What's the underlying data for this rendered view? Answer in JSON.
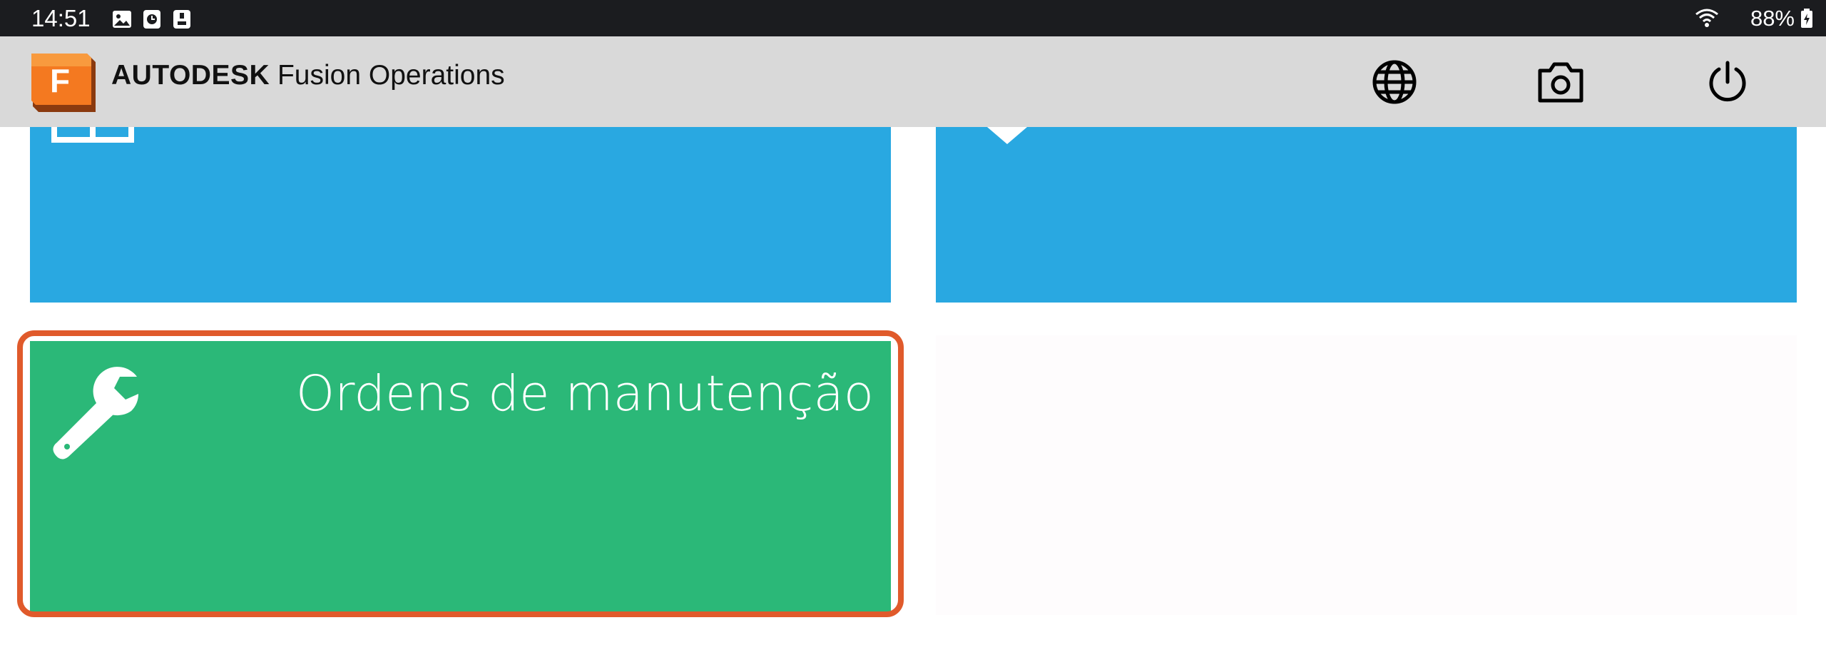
{
  "status_bar": {
    "time": "14:51",
    "battery": "88%",
    "icons": [
      "image-notification-icon",
      "clock-notification-icon",
      "screenshot-notification-icon",
      "wifi-icon",
      "battery-charging-icon"
    ]
  },
  "app_bar": {
    "logo_letter": "F",
    "brand_company": "AUTODESK",
    "brand_product": "Fusion Operations",
    "actions": [
      "globe-icon",
      "camera-icon",
      "power-icon"
    ]
  },
  "tiles": {
    "maintenance": {
      "title": "Ordens de manutenção",
      "icon": "wrench-icon"
    }
  },
  "colors": {
    "tile_blue": "#29a8e1",
    "tile_green": "#2bb878",
    "highlight": "#e05a2b",
    "app_bar_bg": "#d9d9d9",
    "logo_orange": "#f58220"
  }
}
